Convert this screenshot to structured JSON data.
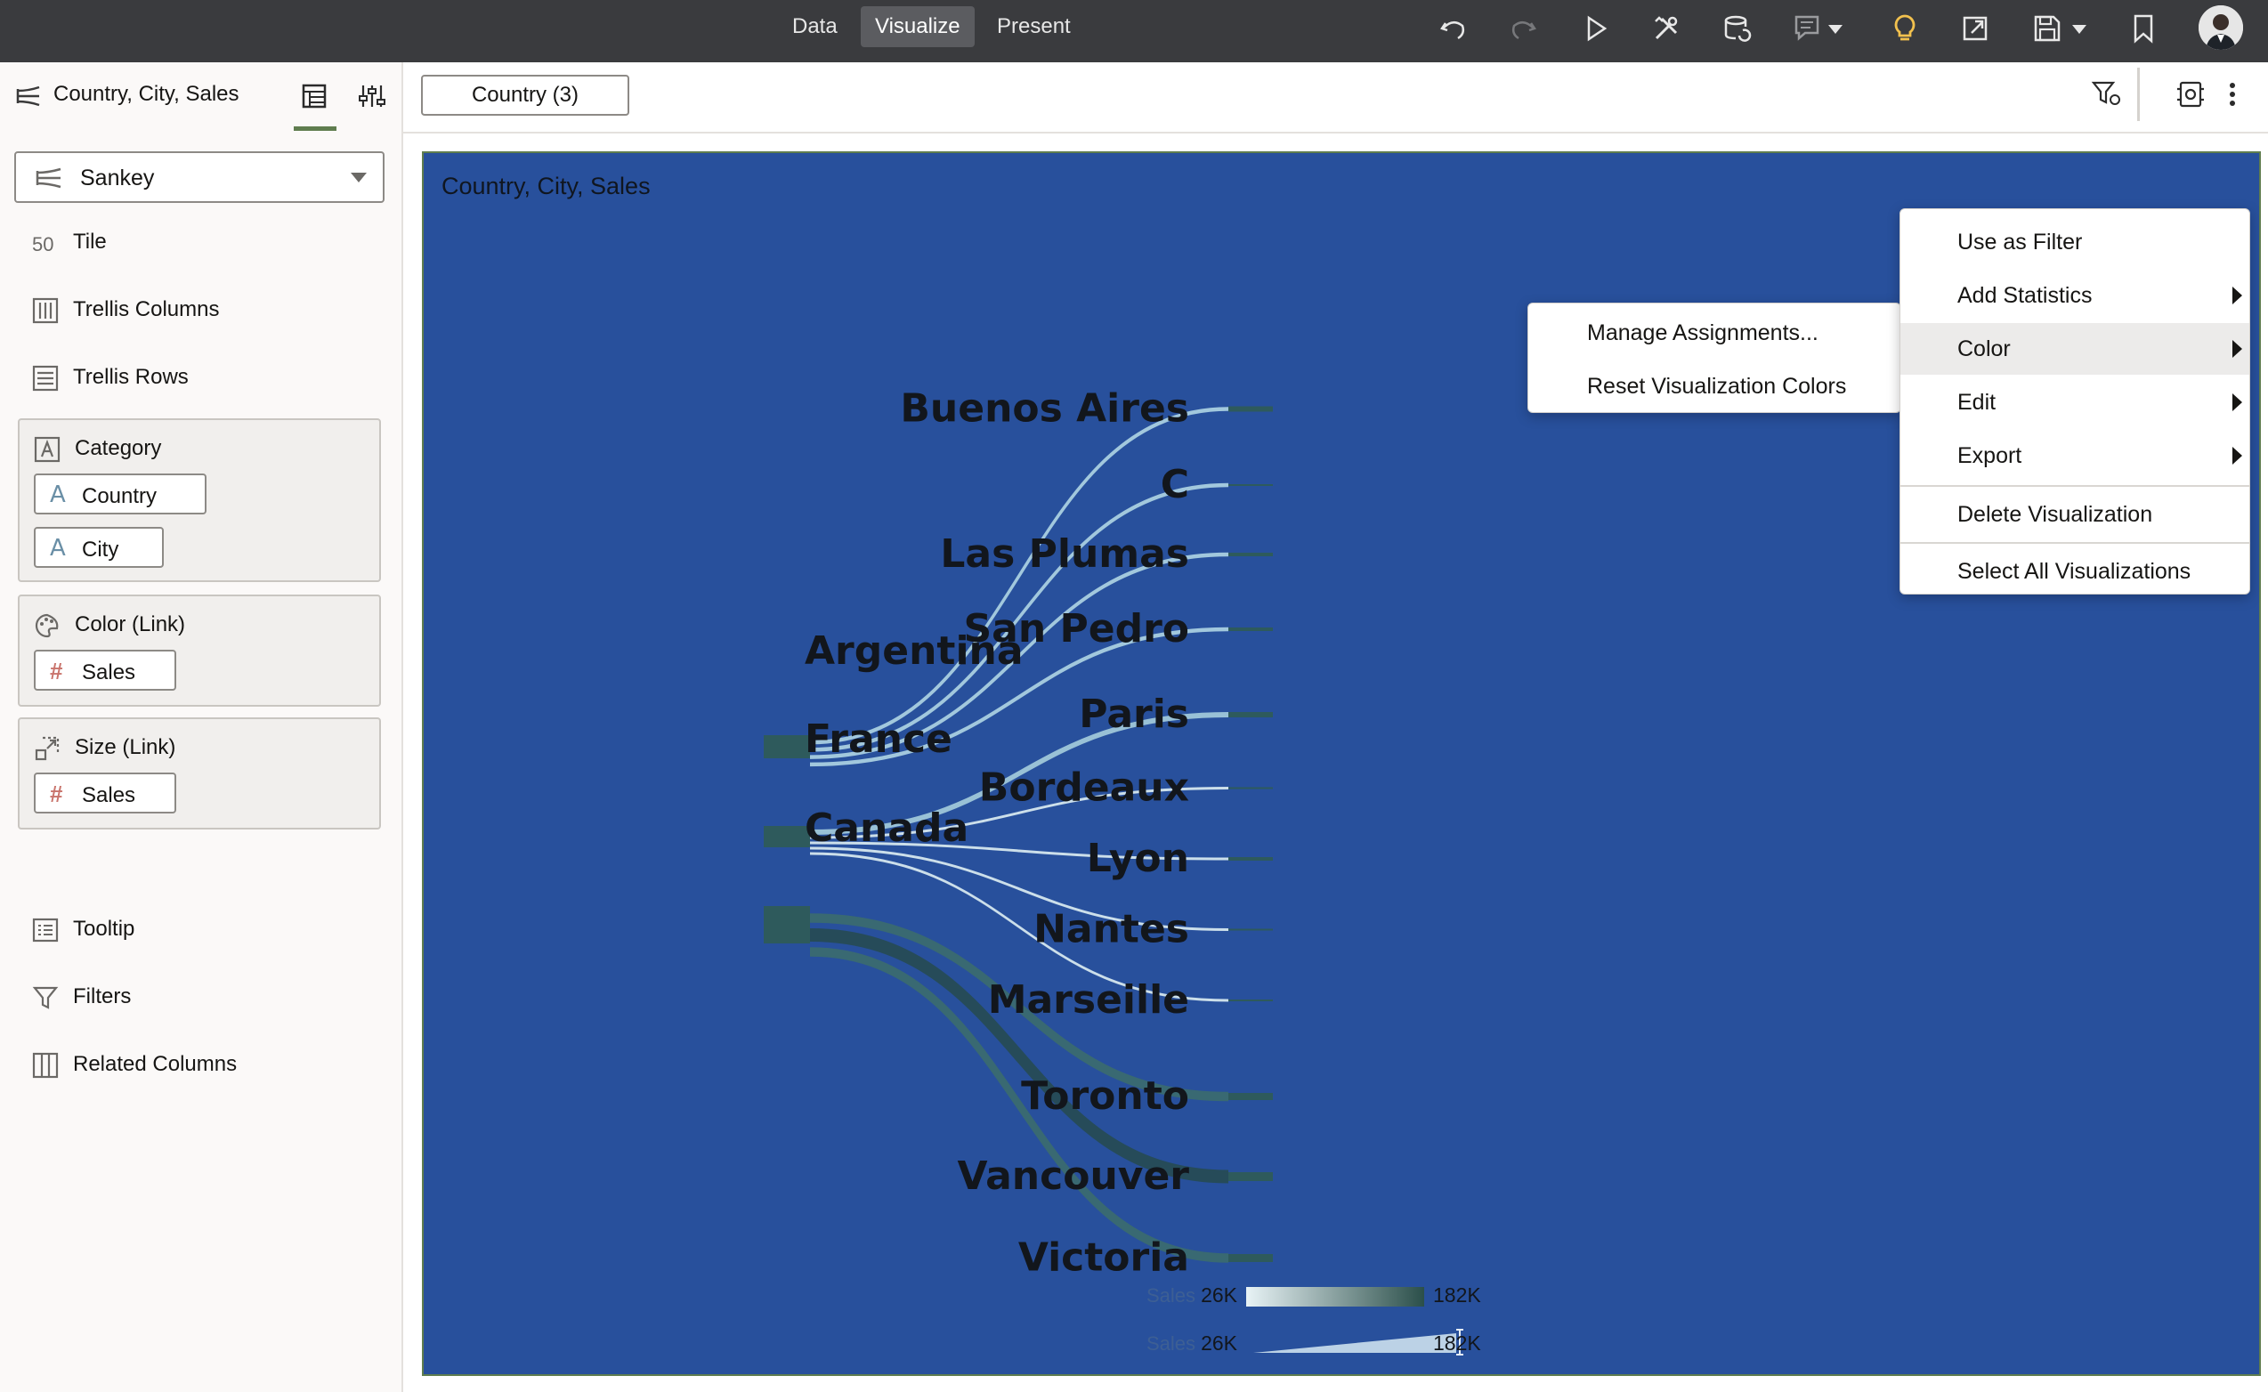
{
  "topbar": {
    "tabs": [
      {
        "label": "Data",
        "active": false
      },
      {
        "label": "Visualize",
        "active": true
      },
      {
        "label": "Present",
        "active": false
      }
    ],
    "icons": [
      "undo-icon",
      "redo-icon",
      "play-icon",
      "tools-icon",
      "data-refresh-icon",
      "comment-icon",
      "lightbulb-icon",
      "export-icon",
      "save-icon",
      "bookmark-icon"
    ],
    "accent_color": "#f2c14e"
  },
  "left_panel": {
    "title": "Country, City, Sales",
    "viz_type": "Sankey",
    "rows": {
      "tile": "Tile",
      "trellis_columns": "Trellis Columns",
      "trellis_rows": "Trellis Rows",
      "tooltip": "Tooltip",
      "filters": "Filters",
      "related_columns": "Related Columns"
    },
    "groups": {
      "category": {
        "label": "Category",
        "items": [
          "Country",
          "City"
        ]
      },
      "color_link": {
        "label": "Color (Link)",
        "items": [
          "Sales"
        ]
      },
      "size_link": {
        "label": "Size (Link)",
        "items": [
          "Sales"
        ]
      }
    },
    "tile_icon_text": "50"
  },
  "filter_bar": {
    "filter_pill": "Country (3)"
  },
  "canvas": {
    "title": "Country, City, Sales",
    "background_color": "#28509c"
  },
  "chart_data": {
    "type": "sankey",
    "sources": [
      {
        "name": "Argentina",
        "targets": [
          "Buenos Aires",
          "C",
          "Las Plumas",
          "San Pedro"
        ]
      },
      {
        "name": "France",
        "targets": [
          "Paris",
          "Bordeaux",
          "Lyon",
          "Nantes",
          "Marseille"
        ]
      },
      {
        "name": "Canada",
        "targets": [
          "Toronto",
          "Vancouver",
          "Victoria"
        ]
      }
    ],
    "targets": [
      "Buenos Aires",
      "C",
      "Las Plumas",
      "San Pedro",
      "Paris",
      "Bordeaux",
      "Lyon",
      "Nantes",
      "Marseille",
      "Toronto",
      "Vancouver",
      "Victoria"
    ],
    "legend": {
      "color": {
        "label": "Sales",
        "min": "26K",
        "max": "182K"
      },
      "size": {
        "label": "Sales",
        "min": "26K",
        "max": "182K"
      }
    },
    "colors": {
      "low": "#e8f3f6",
      "high": "#2b4f4a"
    }
  },
  "context_menu": {
    "items": [
      {
        "label": "Use as Filter",
        "submenu": false
      },
      {
        "label": "Add Statistics",
        "submenu": true
      },
      {
        "label": "Color",
        "submenu": true,
        "highlighted": true
      },
      {
        "label": "Edit",
        "submenu": true
      },
      {
        "label": "Export",
        "submenu": true
      },
      {
        "label": "Delete Visualization",
        "submenu": false
      },
      {
        "label": "Select All Visualizations",
        "submenu": false
      }
    ],
    "color_submenu": [
      "Manage Assignments...",
      "Reset Visualization Colors"
    ]
  }
}
